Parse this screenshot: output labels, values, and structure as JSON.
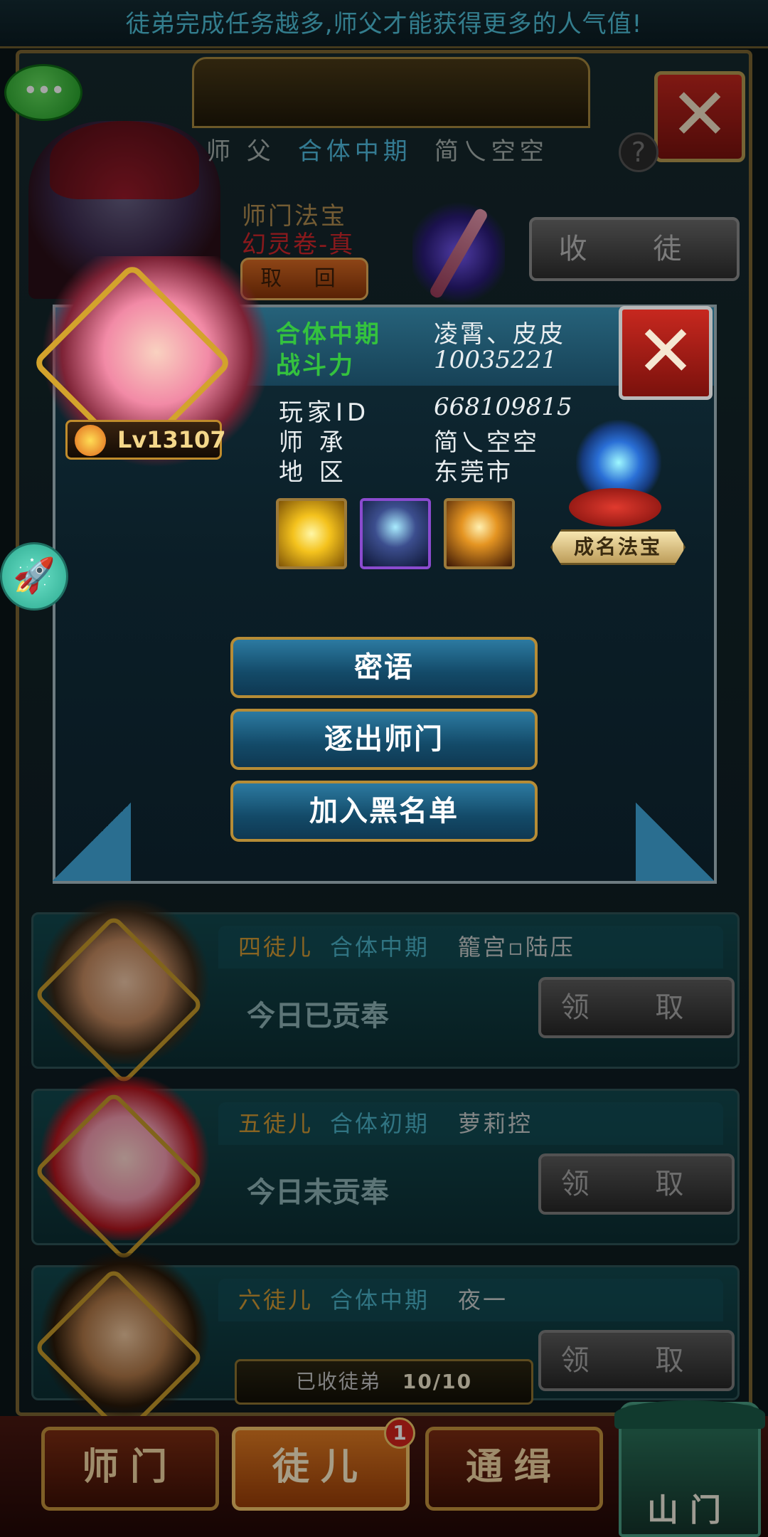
{
  "top_tip": "徒弟完成任务越多,师父才能获得更多的人气值!",
  "master": {
    "role": "师 父",
    "realm": "合体中期",
    "name": "简乀空空",
    "help": "?",
    "treasure_title": "师门法宝",
    "treasure_name": "幻灵卷-真",
    "retrieve_btn": "取 回",
    "collect_btn": "收 徒"
  },
  "popup": {
    "realm": "合体中期",
    "name": "凌霄、皮皮",
    "power_label": "战斗力",
    "power": "10035221",
    "level": "Lv13107",
    "rows": [
      {
        "label": "玩家ID",
        "value": "668109815"
      },
      {
        "label": "师 承",
        "value": "简乀空空"
      },
      {
        "label": "地 区",
        "value": "东莞市"
      }
    ],
    "fame_treasure_label": "成名法宝",
    "actions": [
      "密语",
      "逐出师门",
      "加入黑名单"
    ],
    "close": "✕"
  },
  "disciples": [
    {
      "rank": "四徒儿",
      "realm": "合体中期",
      "name": "籠宫▫陆压",
      "status": "今日已贡奉",
      "claim": "领 取"
    },
    {
      "rank": "五徒儿",
      "realm": "合体初期",
      "name": "萝莉控",
      "status": "今日未贡奉",
      "claim": "领 取"
    },
    {
      "rank": "六徒儿",
      "realm": "合体中期",
      "name": "夜一",
      "status": "",
      "claim": "领 取"
    }
  ],
  "disciple_count": {
    "label": "已收徒弟",
    "value": "10/10"
  },
  "tabs": [
    "师门",
    "徒儿",
    "通缉"
  ],
  "badge": "1",
  "mountain_gate": "山门",
  "chat_icon_text": "•••",
  "close_outer": "✕",
  "colors": {
    "accent_gold": "#c3923c",
    "realm_green": "#34c23e",
    "realm_blue": "#4bb2c8",
    "danger_red": "#c7281f"
  }
}
